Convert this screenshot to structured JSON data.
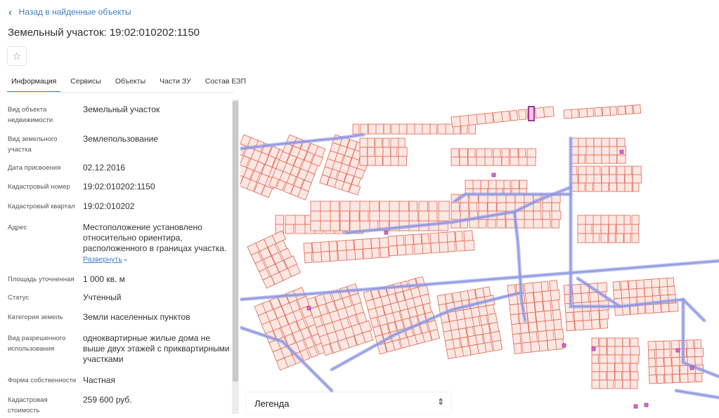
{
  "nav": {
    "back_label": "Назад в найденные объекты"
  },
  "page": {
    "title": "Земельный участок: 19:02:010202:1150"
  },
  "tabs": [
    {
      "label": "Информация",
      "active": true
    },
    {
      "label": "Сервисы"
    },
    {
      "label": "Объекты"
    },
    {
      "label": "Части ЗУ"
    },
    {
      "label": "Состав ЕЗП"
    }
  ],
  "info": {
    "rows": [
      {
        "label": "Вид объекта недвижимости",
        "value": "Земельный участок"
      },
      {
        "label": "Вид земельного участка",
        "value": "Землепользование"
      },
      {
        "label": "Дата присвоения",
        "value": "02.12.2016"
      },
      {
        "label": "Кадастровый номер",
        "value": "19:02:010202:1150"
      },
      {
        "label": "Кадастровый квартал",
        "value": "19:02:010202"
      },
      {
        "label": "Адрес",
        "value": "Местоположение установлено относительно ориентира, расположенного в границах участка."
      },
      {
        "label": "Площадь уточненная",
        "value": "1 000 кв. м"
      },
      {
        "label": "Статус",
        "value": "Учтенный"
      },
      {
        "label": "Категория земель",
        "value": "Земли населенных пунктов"
      },
      {
        "label": "Вид разрешенного использования",
        "value": "одноквартирные жилые дома не выше двух этажей с приквартирными участками"
      },
      {
        "label": "Форма собственности",
        "value": "Частная"
      },
      {
        "label": "Кадастровая стоимость",
        "value": "259 600 руб."
      }
    ],
    "expand_label": "Развернуть"
  },
  "map": {
    "legend_label": "Легенда",
    "colors": {
      "parcel_fill": "#fde7e3",
      "parcel_stroke": "#e0654f",
      "road": "#9aa3e8",
      "road_stroke": "#7f89d8",
      "highlight": "#a03a90",
      "small_object": "#d86bd0"
    }
  }
}
